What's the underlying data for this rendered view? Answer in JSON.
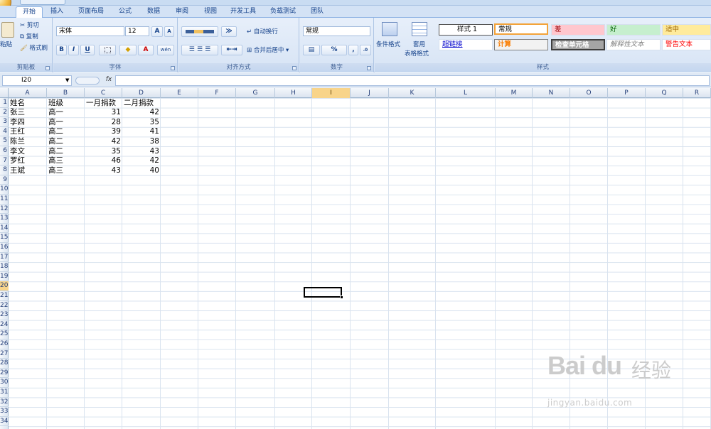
{
  "tabs": [
    "开始",
    "插入",
    "页面布局",
    "公式",
    "数据",
    "审阅",
    "视图",
    "开发工具",
    "负载测试",
    "团队"
  ],
  "clipboard": {
    "paste": "粘贴",
    "cut": "剪切",
    "copy": "复制",
    "format_painter": "格式刷",
    "group": "剪贴板"
  },
  "font": {
    "name": "宋体",
    "size": "12",
    "grow": "A",
    "shrink": "A",
    "bold": "B",
    "italic": "I",
    "underline": "U",
    "font_color": "A",
    "phonetic": "wén",
    "group": "字体"
  },
  "alignment": {
    "wrap": "自动换行",
    "merge": "合并后居中",
    "group": "对齐方式"
  },
  "number": {
    "format": "常规",
    "percent": "%",
    "comma": ",",
    "group": "数字"
  },
  "styles": {
    "conditional": "条件格式",
    "table_format_1": "套用",
    "table_format_2": "表格格式",
    "group": "样式",
    "cells": [
      "样式 1",
      "常规",
      "差",
      "好",
      "适中",
      "超链接",
      "计算",
      "检查单元格",
      "解释性文本",
      "警告文本"
    ]
  },
  "namebox": "I20",
  "fx": "fx",
  "columns": [
    "A",
    "B",
    "C",
    "D",
    "E",
    "F",
    "G",
    "H",
    "I",
    "J",
    "K",
    "L",
    "M",
    "N",
    "O",
    "P",
    "Q",
    "R"
  ],
  "rows": [
    "1",
    "2",
    "3",
    "4",
    "5",
    "6",
    "7",
    "8",
    "9",
    "10",
    "11",
    "12",
    "13",
    "14",
    "15",
    "16",
    "17",
    "18",
    "19",
    "20",
    "21",
    "22",
    "23",
    "24",
    "25",
    "26",
    "27",
    "28",
    "29",
    "30",
    "31",
    "32",
    "33",
    "34"
  ],
  "table": {
    "headers": [
      "姓名",
      "班级",
      "一月捐款",
      "二月捐款"
    ],
    "rows": [
      [
        "张三",
        "高一",
        "31",
        "42"
      ],
      [
        "李四",
        "高一",
        "28",
        "35"
      ],
      [
        "王红",
        "高二",
        "39",
        "41"
      ],
      [
        "陈兰",
        "高二",
        "42",
        "38"
      ],
      [
        "李文",
        "高二",
        "35",
        "43"
      ],
      [
        "罗红",
        "高三",
        "46",
        "42"
      ],
      [
        "王斌",
        "高三",
        "43",
        "40"
      ]
    ]
  },
  "watermark": {
    "main": "Bai du",
    "cn": "经验",
    "url": "jingyan.baidu.com"
  },
  "colors": {
    "ribbon": "#dbe6f4",
    "accent": "#15428b",
    "active_col": "#f8d48a"
  }
}
